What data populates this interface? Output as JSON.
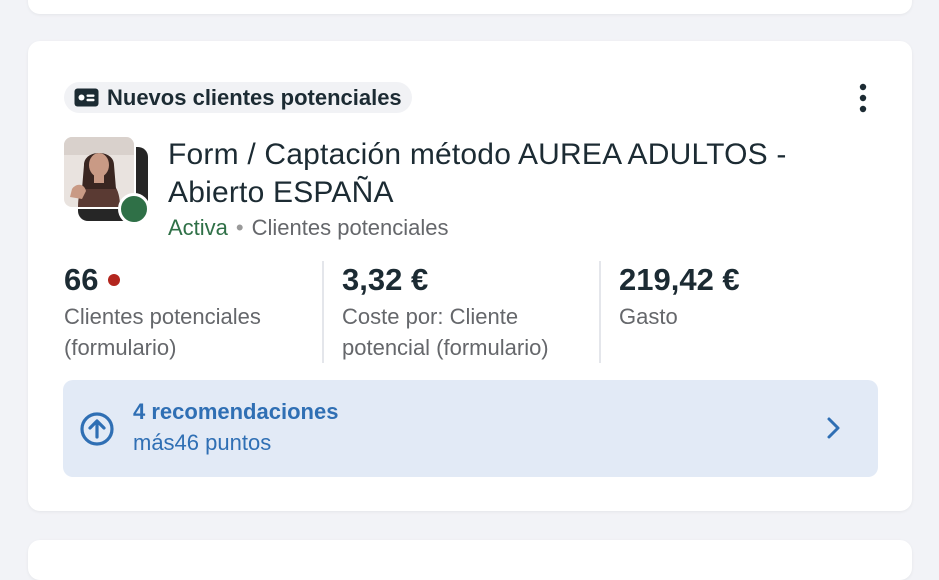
{
  "objective": {
    "label": "Nuevos clientes potenciales",
    "icon": "lead-form-icon"
  },
  "more_menu": {
    "icon": "more-vertical-icon"
  },
  "ad": {
    "title": "Form / Captación método AUREA ADULTOS - Abierto ESPAÑA",
    "status": "Activa",
    "type": "Clientes potenciales",
    "status_color": "#2f7047"
  },
  "metrics": [
    {
      "value": "66",
      "label": "Clientes potenciales (formulario)",
      "alert": true
    },
    {
      "value": "3,32 €",
      "label": "Coste por: Cliente potencial (formulario)"
    },
    {
      "value": "219,42 €",
      "label": "Gasto"
    }
  ],
  "recommendations": {
    "title": "4 recomendaciones",
    "subtitle": "más46 puntos",
    "accent": "#2f6fb4",
    "icon": "arrow-up-circle-icon"
  }
}
